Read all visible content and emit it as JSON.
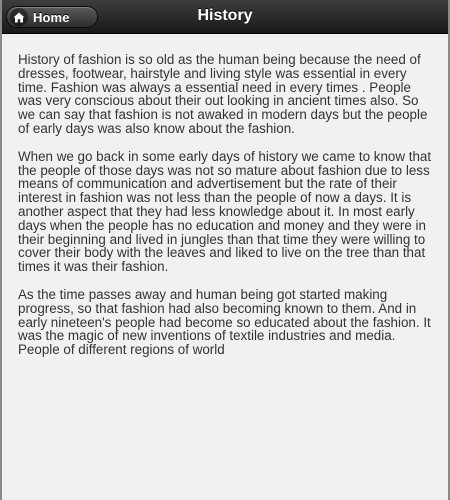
{
  "header": {
    "title": "History",
    "home_label": "Home",
    "home_icon": "home-icon"
  },
  "colors": {
    "header_bg": "#262626",
    "content_bg": "#f1f1f1",
    "text": "#333333"
  },
  "content": {
    "paragraphs": [
      "History of fashion is so old as the human being because the need of dresses, footwear, hairstyle and living style was essential in every time. Fashion was always a essential need in every times . People was very conscious about their out looking in ancient times also. So we can say that fashion is not awaked in modern days but the people of early days was also know about the fashion.",
      "When we go back in some early days of history we came to know that the people of those days was not so mature about fashion due to less means of communication and advertisement but the rate of their interest in fashion was not less than the people of now a days. It is another aspect that they had less knowledge about it. In most early days when the people has no education and money and they were in their beginning and lived in jungles than that time they were willing to cover their body with the leaves and liked to live on the tree than that times it was their fashion.",
      "As the time passes away and human being got started making progress, so that fashion had also becoming known to them. And in early nineteen's people had become so educated about the fashion. It was the magic of new inventions of textile industries and media. People of different regions of world"
    ]
  }
}
